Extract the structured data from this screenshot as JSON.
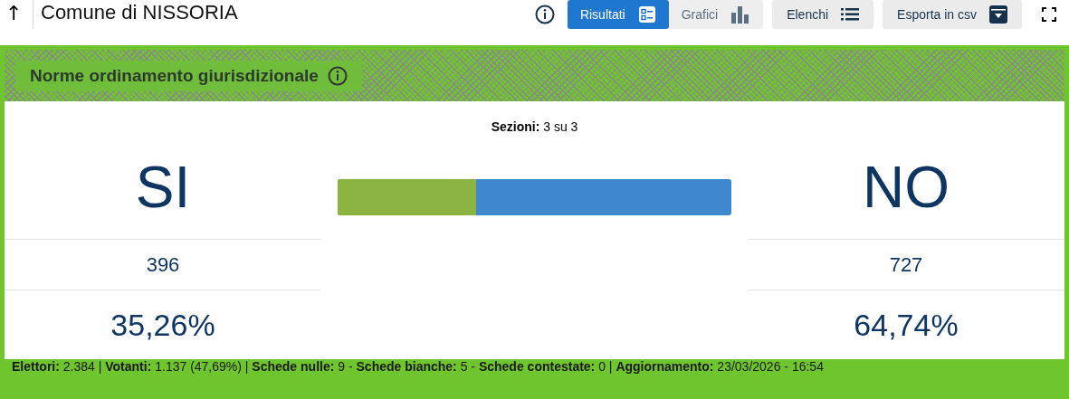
{
  "header": {
    "back_icon": "↑",
    "title": "Comune di NISSORIA"
  },
  "view_tabs": [
    {
      "label": "Risultati",
      "selected": true
    },
    {
      "label": "Grafici",
      "selected": false
    }
  ],
  "buttons": [
    "Elenchi",
    "Esporta in csv"
  ],
  "panel": {
    "title": "Norme ordinamento giurisdizionale",
    "sections": "**Sezioni:** 3 su 3",
    "bar": {
      "level": 0.3526
    },
    "options": [
      {
        "label": "SI",
        "votes": "396",
        "percent": "35,26%"
      },
      {
        "label": "NO",
        "votes": "727",
        "percent": "64,74%"
      }
    ]
  },
  "footer": "**Elettori:** 2.384 | **Votanti:** 1.137 (47,69%) | **Schede nulle:** 9 - **Schede bianche:** 5 - **Schede contestate:** 0 | **Aggiornamento:** 23/03/2026 - 16:54"
}
